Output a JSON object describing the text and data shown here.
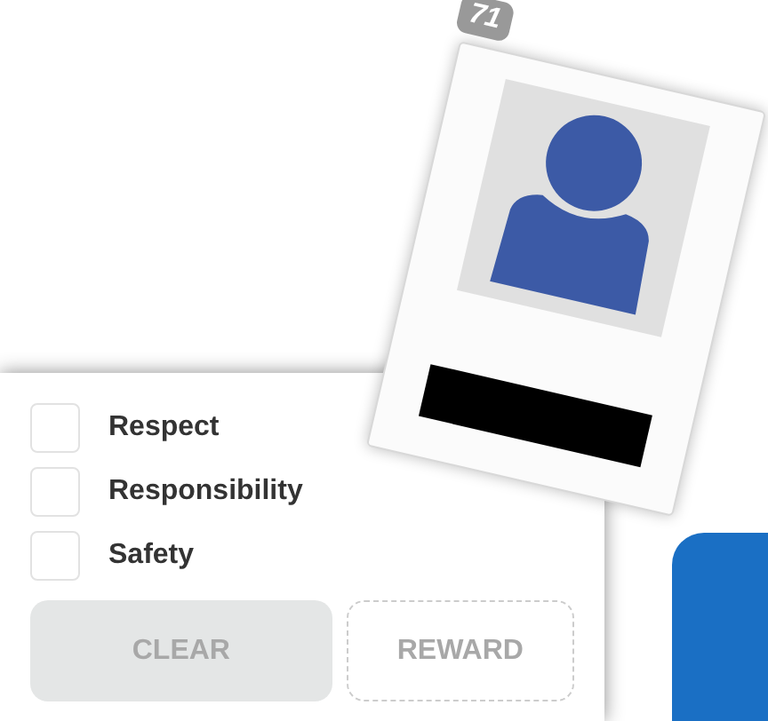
{
  "card": {
    "badge": "71"
  },
  "checklist": [
    {
      "label": "Respect",
      "checked": false
    },
    {
      "label": "Responsibility",
      "checked": false
    },
    {
      "label": "Safety",
      "checked": false
    }
  ],
  "buttons": [
    {
      "label": "CLEAR",
      "kind": "filled",
      "disabled": true
    },
    {
      "label": "REWARD",
      "kind": "dashed",
      "disabled": true
    }
  ]
}
